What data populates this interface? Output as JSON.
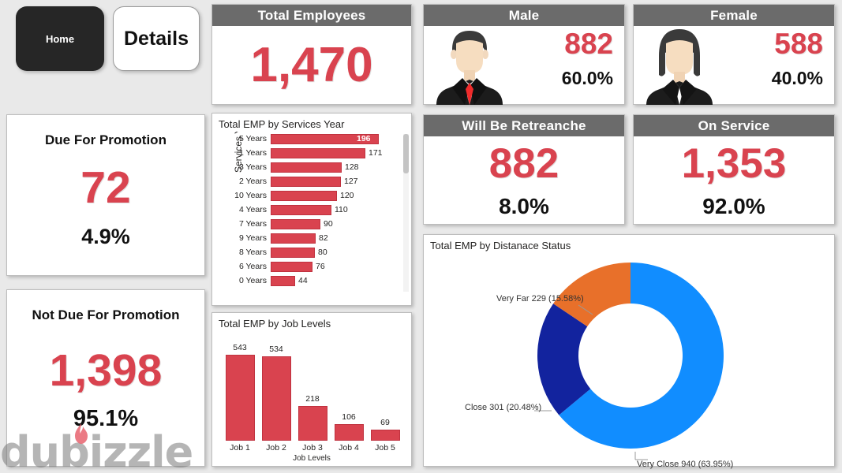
{
  "nav": {
    "home_label": "Home",
    "details_label": "Details"
  },
  "kpis": {
    "total_employees": {
      "title": "Total Employees",
      "value": "1,470"
    },
    "male": {
      "title": "Male",
      "value": "882",
      "percent": "60.0%",
      "icon": "male-avatar-icon"
    },
    "female": {
      "title": "Female",
      "value": "588",
      "percent": "40.0%",
      "icon": "female-avatar-icon"
    },
    "retrench": {
      "title": "Will Be Retreanche",
      "value": "882",
      "percent": "8.0%"
    },
    "on_service": {
      "title": "On Service",
      "value": "1,353",
      "percent": "92.0%"
    },
    "due_promotion": {
      "title": "Due For Promotion",
      "value": "72",
      "percent": "4.9%"
    },
    "not_due_promotion": {
      "title": "Not Due For Promotion",
      "value": "1,398",
      "percent": "95.1%"
    }
  },
  "watermark": {
    "text": "dubizzle",
    "icon": "flame-icon"
  },
  "colors": {
    "accent_red": "#d9434f",
    "header_gray": "#6b6b6b",
    "donut_blue": "#118dff",
    "donut_navy": "#12239e",
    "donut_orange": "#e8702a",
    "page_bg": "#e9e9e9"
  },
  "chart_data": [
    {
      "type": "bar",
      "orientation": "horizontal",
      "title": "Total EMP by Services Year",
      "ylabel": "Services Year",
      "xlabel": "",
      "categories": [
        "5 Years",
        "1 Years",
        "3 Years",
        "2 Years",
        "10 Years",
        "4 Years",
        "7 Years",
        "9 Years",
        "8 Years",
        "6 Years",
        "0 Years"
      ],
      "values": [
        196,
        171,
        128,
        127,
        120,
        110,
        90,
        82,
        80,
        76,
        44
      ],
      "xlim": [
        0,
        200
      ],
      "grid": false,
      "legend": "none",
      "scrollable": true
    },
    {
      "type": "bar",
      "orientation": "vertical",
      "title": "Total EMP by Job Levels",
      "xlabel": "Job Levels",
      "ylabel": "",
      "categories": [
        "Job 1",
        "Job 2",
        "Job 3",
        "Job 4",
        "Job 5"
      ],
      "values": [
        543,
        534,
        218,
        106,
        69
      ],
      "ylim": [
        0,
        560
      ],
      "grid": false,
      "legend": "none"
    },
    {
      "type": "pie",
      "variant": "donut",
      "title": "Total EMP by Distanace Status",
      "labels": [
        "Very Close",
        "Close",
        "Very Far"
      ],
      "values": [
        940,
        301,
        229
      ],
      "percents": [
        "63.95%",
        "20.48%",
        "15.58%"
      ],
      "annotations": [
        "Very Close 940 (63.95%)",
        "Close 301 (20.48%)",
        "Very Far 229 (15.58%)"
      ],
      "colors": [
        "#118dff",
        "#12239e",
        "#e8702a"
      ],
      "legend": "none"
    }
  ]
}
